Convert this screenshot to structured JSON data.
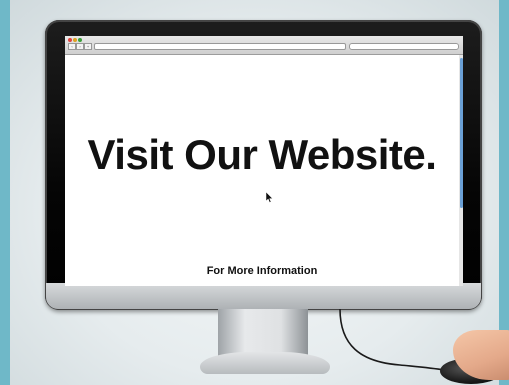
{
  "page": {
    "headline": "Visit Our Website.",
    "footer_text": "For More Information"
  },
  "browser": {
    "nav_back_symbol": "‹",
    "nav_forward_symbol": "›",
    "nav_add_symbol": "+"
  },
  "icons": {
    "close": "close-icon",
    "minimize": "minimize-icon",
    "zoom": "zoom-icon",
    "pointer": "mouse-pointer-icon"
  },
  "colors": {
    "accent_teal": "#6fb8c8",
    "text": "#111111",
    "scroll_thumb": "#6aa0d6"
  }
}
